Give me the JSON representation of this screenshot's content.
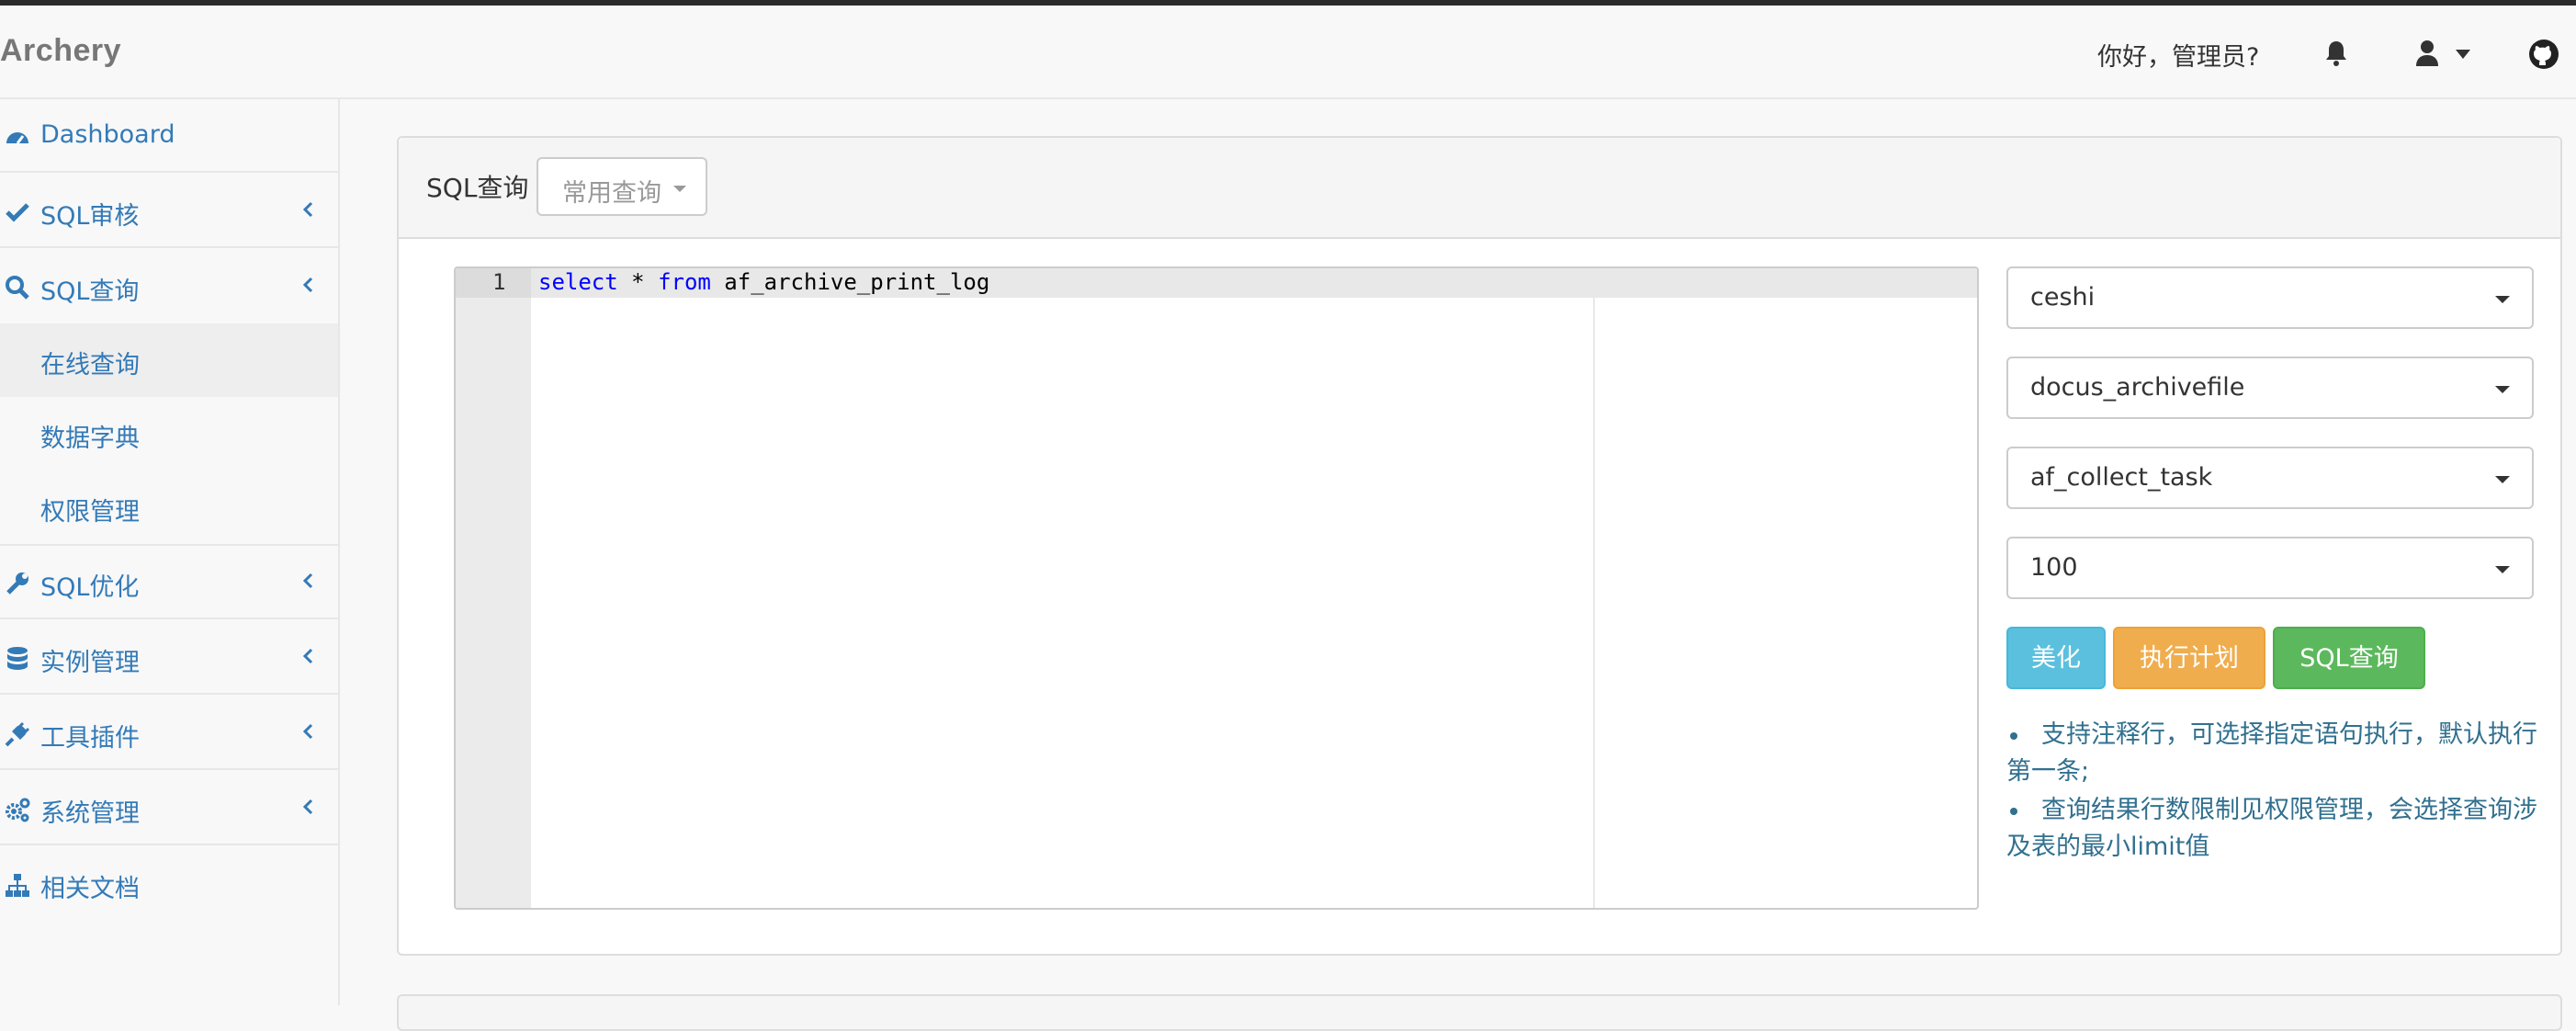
{
  "app": {
    "brand": "Archery"
  },
  "header": {
    "greeting": "你好，管理员?"
  },
  "sidebar": {
    "items": [
      {
        "label": "Dashboard",
        "icon": "dashboard-icon"
      },
      {
        "label": "SQL审核",
        "icon": "check-icon"
      },
      {
        "label": "SQL查询",
        "icon": "search-icon"
      },
      {
        "label": "在线查询"
      },
      {
        "label": "数据字典"
      },
      {
        "label": "权限管理"
      },
      {
        "label": "SQL优化",
        "icon": "wrench-icon"
      },
      {
        "label": "实例管理",
        "icon": "database-icon"
      },
      {
        "label": "工具插件",
        "icon": "plug-icon"
      },
      {
        "label": "系统管理",
        "icon": "gears-icon"
      },
      {
        "label": "相关文档",
        "icon": "sitemap-icon"
      }
    ]
  },
  "panel": {
    "title": "SQL查询",
    "common_query_label": "常用查询"
  },
  "editor": {
    "line_number": "1",
    "code_keyword1": "select",
    "code_mid": " * ",
    "code_keyword2": "from",
    "code_rest": " af_archive_print_log"
  },
  "selects": {
    "instance": "ceshi",
    "database": "docus_archivefile",
    "table": "af_collect_task",
    "limit": "100"
  },
  "buttons": {
    "beautify": "美化",
    "explain": "执行计划",
    "query": "SQL查询"
  },
  "notes": [
    "支持注释行，可选择指定语句执行，默认执行第一条;",
    "查询结果行数限制见权限管理，会选择查询涉及表的最小limit值"
  ],
  "colors": {
    "link": "#337ab7",
    "info": "#5bc0de",
    "warning": "#f0ad4e",
    "success": "#5cb85c",
    "note_text": "#31708f"
  }
}
